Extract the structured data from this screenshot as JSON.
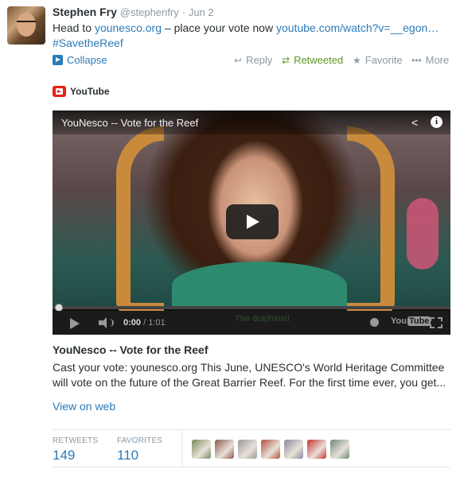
{
  "tweet": {
    "author_name": "Stephen Fry",
    "author_handle": "@stephenfry",
    "separator": "·",
    "date": "Jun 2",
    "text_prefix": "Head to ",
    "link1": "younesco.org",
    "text_mid": " – place your vote now ",
    "link2": "youtube.com/watch?v=__egon…",
    "hashtag": "#SavetheReef"
  },
  "actions": {
    "collapse": "Collapse",
    "reply": "Reply",
    "retweeted": "Retweeted",
    "favorite": "Favorite",
    "more": "More"
  },
  "card": {
    "provider": "YouTube",
    "video_title": "YouNesco -- Vote for the Reef",
    "current_time": "0:00",
    "time_sep": " / ",
    "duration": "1:01",
    "subtitle": "The dolphins!!",
    "yt_you": "You",
    "yt_tube": "Tube",
    "title": "YouNesco -- Vote for the Reef",
    "description": "Cast your vote: younesco.org This June, UNESCO's World Heritage Committee will vote on the future of the Great Barrier Reef. For the first time ever, you get...",
    "view_on_web": "View on web"
  },
  "stats": {
    "retweets_label": "RETWEETS",
    "retweets_value": "149",
    "favorites_label": "FAVORITES",
    "favorites_value": "110"
  },
  "favoriters": [
    {
      "color": "#7a8a5a"
    },
    {
      "color": "#8a5a4a"
    },
    {
      "color": "#9a9a9a"
    },
    {
      "color": "#b0503a"
    },
    {
      "color": "#8a8aa0"
    },
    {
      "color": "#c83030"
    },
    {
      "color": "#6a8a7a"
    }
  ],
  "colors": {
    "link": "#2b7bb9",
    "retweet_green": "#609928",
    "muted": "#8899a6",
    "youtube_red": "#e62117"
  },
  "icons": [
    "collapse-icon",
    "reply-icon",
    "retweet-icon",
    "favorite-star-icon",
    "more-dots-icon",
    "youtube-logo-icon",
    "share-icon",
    "info-icon",
    "play-icon",
    "volume-icon",
    "clock-icon",
    "fullscreen-icon"
  ]
}
